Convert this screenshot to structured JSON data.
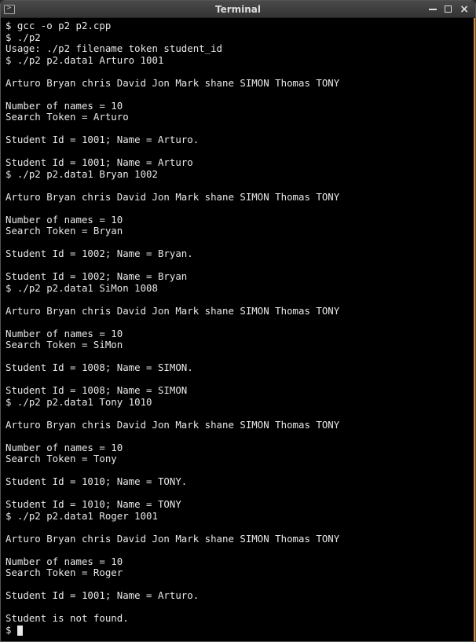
{
  "window": {
    "title": "Terminal"
  },
  "terminal": {
    "lines": [
      "$ gcc -o p2 p2.cpp",
      "$ ./p2",
      "Usage: ./p2 filename token student_id",
      "$ ./p2 p2.data1 Arturo 1001",
      "",
      "Arturo Bryan chris David Jon Mark shane SIMON Thomas TONY",
      "",
      "Number of names = 10",
      "Search Token = Arturo",
      "",
      "Student Id = 1001; Name = Arturo.",
      "",
      "Student Id = 1001; Name = Arturo",
      "$ ./p2 p2.data1 Bryan 1002",
      "",
      "Arturo Bryan chris David Jon Mark shane SIMON Thomas TONY",
      "",
      "Number of names = 10",
      "Search Token = Bryan",
      "",
      "Student Id = 1002; Name = Bryan.",
      "",
      "Student Id = 1002; Name = Bryan",
      "$ ./p2 p2.data1 SiMon 1008",
      "",
      "Arturo Bryan chris David Jon Mark shane SIMON Thomas TONY",
      "",
      "Number of names = 10",
      "Search Token = SiMon",
      "",
      "Student Id = 1008; Name = SIMON.",
      "",
      "Student Id = 1008; Name = SIMON",
      "$ ./p2 p2.data1 Tony 1010",
      "",
      "Arturo Bryan chris David Jon Mark shane SIMON Thomas TONY",
      "",
      "Number of names = 10",
      "Search Token = Tony",
      "",
      "Student Id = 1010; Name = TONY.",
      "",
      "Student Id = 1010; Name = TONY",
      "$ ./p2 p2.data1 Roger 1001",
      "",
      "Arturo Bryan chris David Jon Mark shane SIMON Thomas TONY",
      "",
      "Number of names = 10",
      "Search Token = Roger",
      "",
      "Student Id = 1001; Name = Arturo.",
      "",
      "Student is not found."
    ],
    "prompt": "$ "
  }
}
